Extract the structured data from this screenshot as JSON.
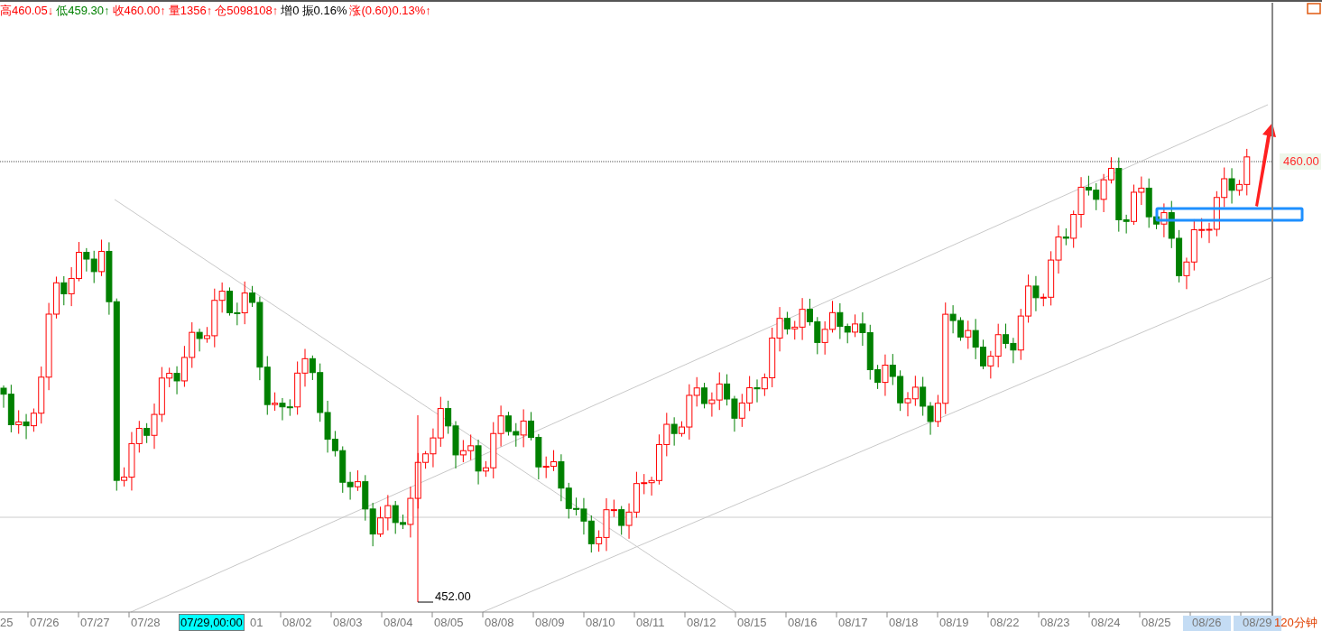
{
  "quote_bar": [
    {
      "text": "高460.05↓",
      "color": "#ff0000"
    },
    {
      "text": "低459.30↑",
      "color": "#008000"
    },
    {
      "text": "收460.00↑",
      "color": "#ff0000"
    },
    {
      "text": "量1356↑",
      "color": "#ff0000"
    },
    {
      "text": "仓5098108↑",
      "color": "#ff0000"
    },
    {
      "text": "增0",
      "color": "#000000"
    },
    {
      "text": "振0.16%",
      "color": "#000000"
    },
    {
      "text": "涨(0.60)0.13%↑",
      "color": "#ff0000"
    }
  ],
  "chart": {
    "price_label": "460.00",
    "low_label": "452.00",
    "cursor_label": "07/29,00:00",
    "period": "120分钟",
    "x_axis": [
      {
        "text": "25",
        "kind": "tail",
        "highlighted": false
      },
      {
        "text": "07/26",
        "kind": "full",
        "highlighted": false
      },
      {
        "text": "07/27",
        "kind": "full",
        "highlighted": false
      },
      {
        "text": "07/28",
        "kind": "full",
        "highlighted": false
      },
      {
        "text": "01",
        "kind": "tail",
        "highlighted": false
      },
      {
        "text": "08/02",
        "kind": "full",
        "highlighted": false
      },
      {
        "text": "08/03",
        "kind": "full",
        "highlighted": false
      },
      {
        "text": "08/04",
        "kind": "full",
        "highlighted": false
      },
      {
        "text": "08/05",
        "kind": "full",
        "highlighted": false
      },
      {
        "text": "08/08",
        "kind": "full",
        "highlighted": false
      },
      {
        "text": "08/09",
        "kind": "full",
        "highlighted": false
      },
      {
        "text": "08/10",
        "kind": "full",
        "highlighted": false
      },
      {
        "text": "08/11",
        "kind": "full",
        "highlighted": false
      },
      {
        "text": "08/12",
        "kind": "full",
        "highlighted": false
      },
      {
        "text": "08/15",
        "kind": "full",
        "highlighted": false
      },
      {
        "text": "08/16",
        "kind": "full",
        "highlighted": false
      },
      {
        "text": "08/17",
        "kind": "full",
        "highlighted": false
      },
      {
        "text": "08/18",
        "kind": "full",
        "highlighted": false
      },
      {
        "text": "08/19",
        "kind": "full",
        "highlighted": false
      },
      {
        "text": "08/22",
        "kind": "full",
        "highlighted": false
      },
      {
        "text": "08/23",
        "kind": "full",
        "highlighted": false
      },
      {
        "text": "08/24",
        "kind": "full",
        "highlighted": false
      },
      {
        "text": "08/25",
        "kind": "full",
        "highlighted": false
      },
      {
        "text": "08/26",
        "kind": "full",
        "highlighted": true
      },
      {
        "text": "08/29",
        "kind": "full",
        "highlighted": true
      }
    ]
  }
}
